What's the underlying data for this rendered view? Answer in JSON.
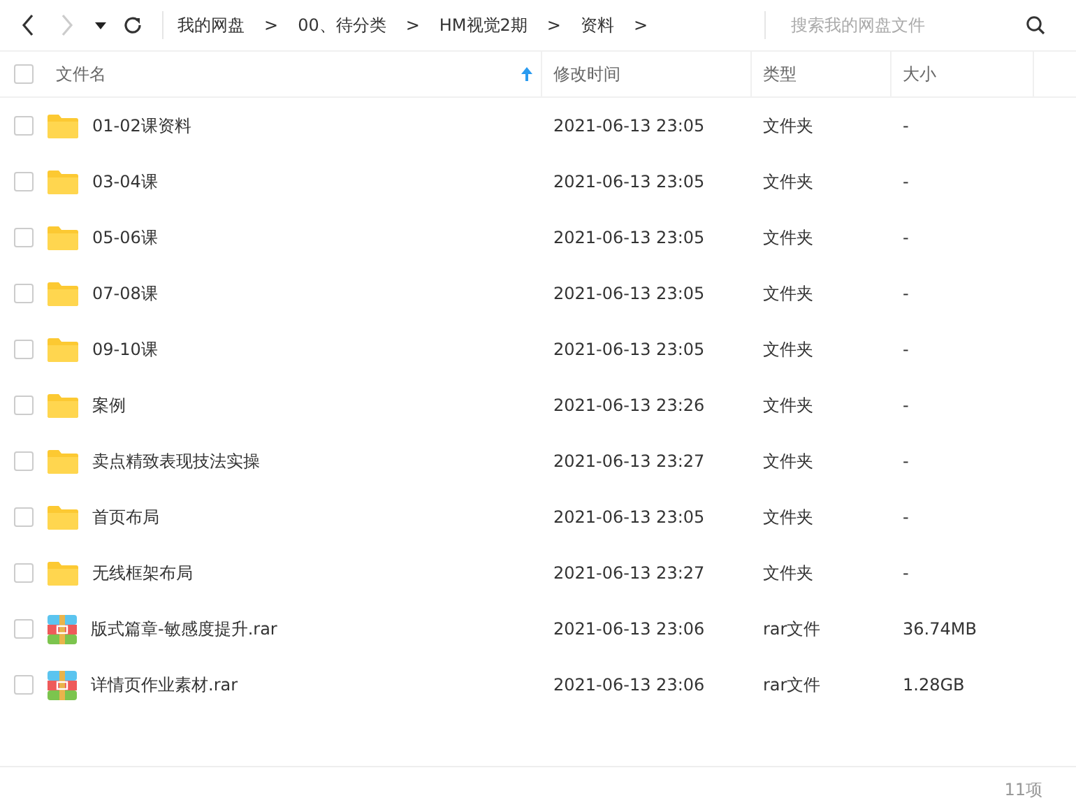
{
  "toolbar": {
    "back_disabled": false,
    "forward_disabled": true
  },
  "breadcrumbs": [
    {
      "label": "我的网盘"
    },
    {
      "label": "00、待分类"
    },
    {
      "label": "HM视觉2期"
    },
    {
      "label": "资料"
    }
  ],
  "breadcrumb_separator": ">",
  "search": {
    "placeholder": "搜索我的网盘文件"
  },
  "table": {
    "select_all_checked": false,
    "columns": [
      {
        "label": "文件名",
        "sorted": true
      },
      {
        "label": "修改时间",
        "sorted": false
      },
      {
        "label": "类型",
        "sorted": false
      },
      {
        "label": "大小",
        "sorted": false
      }
    ],
    "rows": [
      {
        "kind": "folder",
        "checked": false,
        "name": "01-02课资料",
        "modified": "2021-06-13 23:05",
        "type": "文件夹",
        "size": "-"
      },
      {
        "kind": "folder",
        "checked": false,
        "name": "03-04课",
        "modified": "2021-06-13 23:05",
        "type": "文件夹",
        "size": "-"
      },
      {
        "kind": "folder",
        "checked": false,
        "name": "05-06课",
        "modified": "2021-06-13 23:05",
        "type": "文件夹",
        "size": "-"
      },
      {
        "kind": "folder",
        "checked": false,
        "name": "07-08课",
        "modified": "2021-06-13 23:05",
        "type": "文件夹",
        "size": "-"
      },
      {
        "kind": "folder",
        "checked": false,
        "name": "09-10课",
        "modified": "2021-06-13 23:05",
        "type": "文件夹",
        "size": "-"
      },
      {
        "kind": "folder",
        "checked": false,
        "name": "案例",
        "modified": "2021-06-13 23:26",
        "type": "文件夹",
        "size": "-"
      },
      {
        "kind": "folder",
        "checked": false,
        "name": "卖点精致表现技法实操",
        "modified": "2021-06-13 23:27",
        "type": "文件夹",
        "size": "-"
      },
      {
        "kind": "folder",
        "checked": false,
        "name": "首页布局",
        "modified": "2021-06-13 23:05",
        "type": "文件夹",
        "size": "-"
      },
      {
        "kind": "folder",
        "checked": false,
        "name": "无线框架布局",
        "modified": "2021-06-13 23:27",
        "type": "文件夹",
        "size": "-"
      },
      {
        "kind": "archive",
        "checked": false,
        "name": "版式篇章-敏感度提升.rar",
        "modified": "2021-06-13 23:06",
        "type": "rar文件",
        "size": "36.74MB"
      },
      {
        "kind": "archive",
        "checked": false,
        "name": "详情页作业素材.rar",
        "modified": "2021-06-13 23:06",
        "type": "rar文件",
        "size": "1.28GB"
      }
    ]
  },
  "status_bar": {
    "count": "11项"
  }
}
